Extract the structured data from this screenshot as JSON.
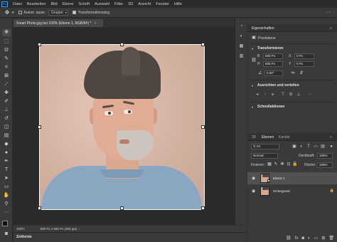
{
  "menubar": {
    "logo": "Ps",
    "items": [
      "Datei",
      "Bearbeiten",
      "Bild",
      "Ebene",
      "Schrift",
      "Auswahl",
      "Filter",
      "3D",
      "Ansicht",
      "Fenster",
      "Hilfe"
    ]
  },
  "options": {
    "auto_select_label": "Autom. ausw.:",
    "auto_select_value": "Gruppe",
    "transform_label": "Transformationsstrg."
  },
  "document": {
    "tab_title": "Smart Photo.jpg bei 100% (Ebene 1, RGB/8#) *",
    "close_glyph": "×"
  },
  "status": {
    "zoom": "100%",
    "size": "500 Px x 500 Px (300 ppi)",
    "arrow": "›"
  },
  "timeline": {
    "label": "Zeitleiste"
  },
  "properties": {
    "tab_active": "Eigenschaften",
    "pixel_layer": "Pixelebene",
    "transform_title": "Transformieren",
    "w_label": "B",
    "w_value": "500 Px",
    "h_label": "H",
    "h_value": "500 Px",
    "x_label": "X",
    "x_value": "0 Px",
    "y_label": "Y",
    "y_value": "0 Px",
    "angle_value": "0,00°",
    "align_title": "Ausrichten und verteilen",
    "quick_title": "Schnellaktionen"
  },
  "layers_panel": {
    "tabs": [
      "3D",
      "Ebenen",
      "Kanäle"
    ],
    "filter_kind": "Art",
    "blend_mode": "Normal",
    "opacity_label": "Deckkraft:",
    "opacity_value": "100%",
    "lock_label": "Fixieren:",
    "fill_label": "Fläche:",
    "fill_value": "100%",
    "layers": [
      {
        "name": "Ebene 1",
        "selected": true,
        "locked": false
      },
      {
        "name": "Hintergrund",
        "selected": false,
        "locked": true
      }
    ]
  },
  "colors": {
    "foreground": "#111111",
    "background": "#f0f0f0",
    "accent": "#31a8ff"
  }
}
